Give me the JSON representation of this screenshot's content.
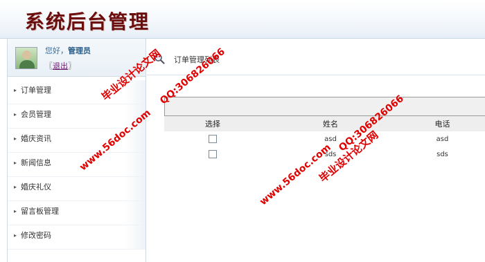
{
  "header": {
    "app_title": "系统后台管理"
  },
  "sidebar": {
    "greeting_prefix": "您好，",
    "greeting_user": "管理员",
    "logout_open": "〖",
    "logout_label": "退出",
    "logout_close": "〗",
    "menu": [
      {
        "label": "订单管理"
      },
      {
        "label": "会员管理"
      },
      {
        "label": "婚庆资讯"
      },
      {
        "label": "新闻信息"
      },
      {
        "label": "婚庆礼仪"
      },
      {
        "label": "留言板管理"
      },
      {
        "label": "修改密码"
      }
    ]
  },
  "content": {
    "breadcrumb": "订单管理列表",
    "table": {
      "headers": [
        "选择",
        "姓名",
        "电话"
      ],
      "rows": [
        {
          "name": "asd",
          "phone": "asd"
        },
        {
          "name": "sds",
          "phone": "sds"
        }
      ]
    }
  },
  "watermarks": [
    {
      "text": "毕业设计论文网"
    },
    {
      "text": "www.56doc.com"
    },
    {
      "text": "QQ:306826066"
    },
    {
      "text": "www.56doc.com"
    },
    {
      "text": "QQ:306826066"
    },
    {
      "text": "毕业设计论文网"
    }
  ]
}
